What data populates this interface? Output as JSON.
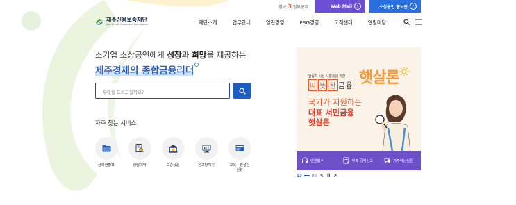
{
  "utility": {
    "logo_text": "정보",
    "logo_number": "3",
    "logo_suffix": "정부공개",
    "web_mail": "Web Mail",
    "biz_promo": "소상공인 홍보관"
  },
  "brand": {
    "name_ko": "제주신용보증재단",
    "name_en": "Jeju Credit Guarantee Foundation"
  },
  "gnb": [
    "재단소개",
    "업무안내",
    "열린경영",
    "ESG경영",
    "고객센터",
    "알림마당"
  ],
  "intro": {
    "line1_a": "소기업 소상공인에게 ",
    "line1_b": "성장",
    "line1_c": "과 ",
    "line1_d": "희망",
    "line1_e": "을 제공하는",
    "line2": "제주경제의 종합금융리더"
  },
  "search": {
    "placeholder": "무엇을 도와드릴까요?"
  },
  "faq": {
    "title": "자주 찾는 서비스",
    "items": [
      {
        "label": "금리현황표",
        "icon": "folder-icon"
      },
      {
        "label": "상담예약",
        "icon": "document-search-icon"
      },
      {
        "label": "보증상품",
        "icon": "bank-icon"
      },
      {
        "label": "온고당지기",
        "icon": "monitor-chart-icon"
      },
      {
        "label": "교육 · 컨설팅\n신청",
        "icon": "card-icon"
      }
    ]
  },
  "promo": {
    "small_text": "열심히 사는 사람들을 위한",
    "warm_box1": "따",
    "warm_box2": "뜻",
    "warm_box3": "한",
    "warm_tail": "금융",
    "brand": "햇살론",
    "gov": "국가가 지원하는",
    "main1": "대표 서민금융",
    "main2": "햇살론"
  },
  "quick": [
    {
      "label": "민원접수",
      "icon": "headset-icon"
    },
    {
      "label": "부패·공익신고",
      "icon": "report-icon"
    },
    {
      "label": "자주하는질문",
      "icon": "faq-icon"
    }
  ],
  "pager": {
    "current": "03",
    "total": "08"
  },
  "colors": {
    "primary": "#1b5dc0",
    "promo_purple": "#6c4fc9",
    "promo_orange": "#e9572e"
  }
}
